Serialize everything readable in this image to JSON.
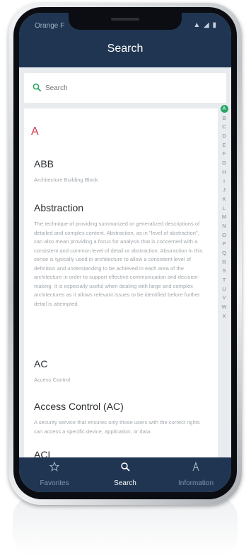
{
  "status_bar": {
    "carrier": "Orange F",
    "icons": "▲ ◢ ▮"
  },
  "header": {
    "title": "Search"
  },
  "search": {
    "placeholder": "Search"
  },
  "section_letter": "A",
  "entries": [
    {
      "term": "ABB",
      "definition": "Architecture Building Block"
    },
    {
      "term": "Abstraction",
      "definition": "The technique of providing summarized or generalized descriptions of detailed and complex content. Abstraction, as in \"level of abstraction\", can also mean providing a focus for analysis that is concerned with a consistent and common level of detail or abstraction. Abstraction in this sense is typically used in architecture to allow a consistent level of definition and understanding to be achieved in each area of the architecture in order to support effective communication and decision-making. It is especially useful when dealing with large and complex architectures as it allows relevant issues to be identified before further detail is attempted."
    },
    {
      "term": "AC",
      "definition": "Access Control"
    },
    {
      "term": "Access Control (AC)",
      "definition": "A security service that ensures only those users with the correct rights can access a specific device, application, or data."
    },
    {
      "term": "ACL",
      "definition": ""
    }
  ],
  "alphabet": [
    "A",
    "B",
    "C",
    "D",
    "E",
    "F",
    "G",
    "H",
    "I",
    "J",
    "K",
    "L",
    "M",
    "N",
    "O",
    "P",
    "Q",
    "R",
    "S",
    "T",
    "U",
    "V",
    "W",
    "X"
  ],
  "alphabet_active": "A",
  "tabs": [
    {
      "label": "Favorites",
      "icon": "star-icon",
      "active": false
    },
    {
      "label": "Search",
      "icon": "search-icon",
      "active": true
    },
    {
      "label": "Information",
      "icon": "info-person-icon",
      "active": false
    }
  ],
  "colors": {
    "bar": "#1f3552",
    "accent": "#28a866",
    "letter": "#d03d52"
  }
}
